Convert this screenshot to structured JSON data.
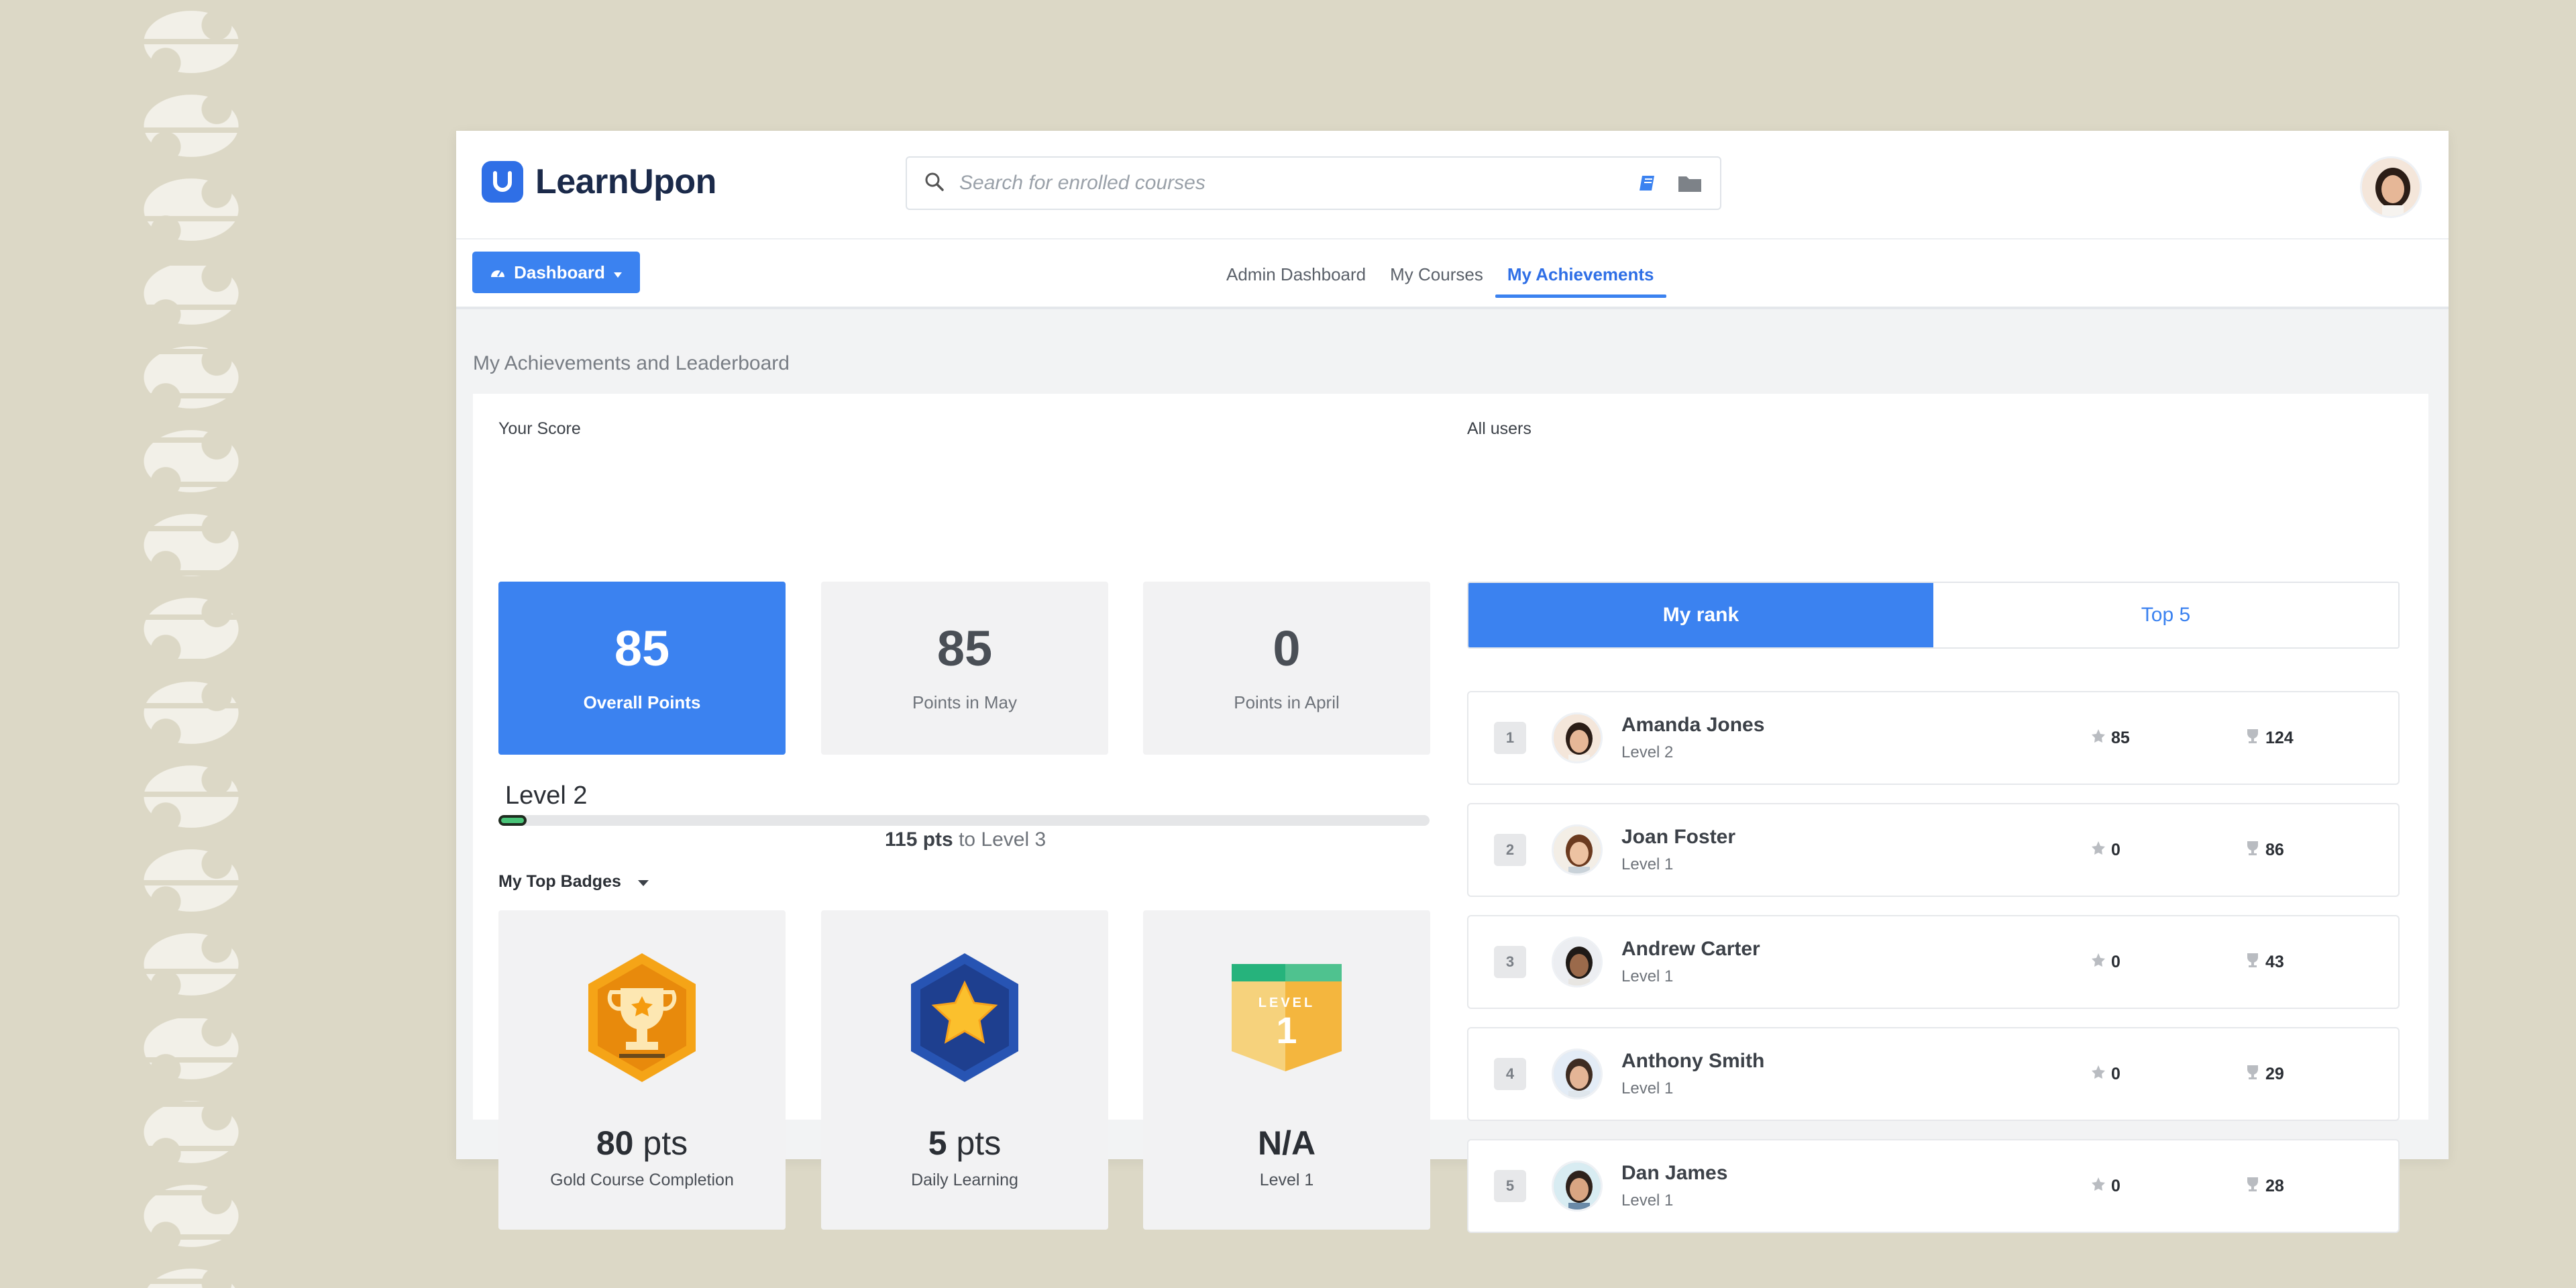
{
  "brand": {
    "name": "LearnUpon",
    "color": "#3b82f0"
  },
  "search": {
    "placeholder": "Search for enrolled courses"
  },
  "nav": {
    "dashboard_button": "Dashboard",
    "tabs": [
      {
        "label": "Admin Dashboard"
      },
      {
        "label": "My Courses"
      },
      {
        "label": "My Achievements",
        "active": true
      }
    ]
  },
  "page": {
    "title": "My Achievements and Leaderboard"
  },
  "score": {
    "label": "Your Score",
    "cards": [
      {
        "value": "85",
        "label": "Overall Points"
      },
      {
        "value": "85",
        "label": "Points in May"
      },
      {
        "value": "0",
        "label": "Points in April"
      }
    ]
  },
  "level": {
    "title": "Level 2",
    "progress_fraction": 0.03,
    "remaining_pts": "115 pts",
    "remaining_suffix": "to Level 3"
  },
  "badges": {
    "label": "My Top Badges",
    "items": [
      {
        "pts": "80",
        "unit": "pts",
        "name": "Gold Course Completion",
        "icon": "trophy-badge-icon"
      },
      {
        "pts": "5",
        "unit": "pts",
        "name": "Daily Learning",
        "icon": "star-badge-icon"
      },
      {
        "pts": "N/A",
        "unit": "",
        "name": "Level 1",
        "icon": "level-badge-icon",
        "icon_text": "LEVEL",
        "icon_num": "1"
      }
    ]
  },
  "leaderboard": {
    "label": "All users",
    "toggle": {
      "my_rank": "My rank",
      "top5": "Top 5"
    },
    "rows": [
      {
        "rank": "1",
        "name": "Amanda Jones",
        "level": "Level 2",
        "points": "85",
        "trophies": "124"
      },
      {
        "rank": "2",
        "name": "Joan Foster",
        "level": "Level 1",
        "points": "0",
        "trophies": "86"
      },
      {
        "rank": "3",
        "name": "Andrew Carter",
        "level": "Level 1",
        "points": "0",
        "trophies": "43"
      },
      {
        "rank": "4",
        "name": "Anthony Smith",
        "level": "Level 1",
        "points": "0",
        "trophies": "29"
      },
      {
        "rank": "5",
        "name": "Dan James",
        "level": "Level 1",
        "points": "0",
        "trophies": "28"
      }
    ]
  }
}
